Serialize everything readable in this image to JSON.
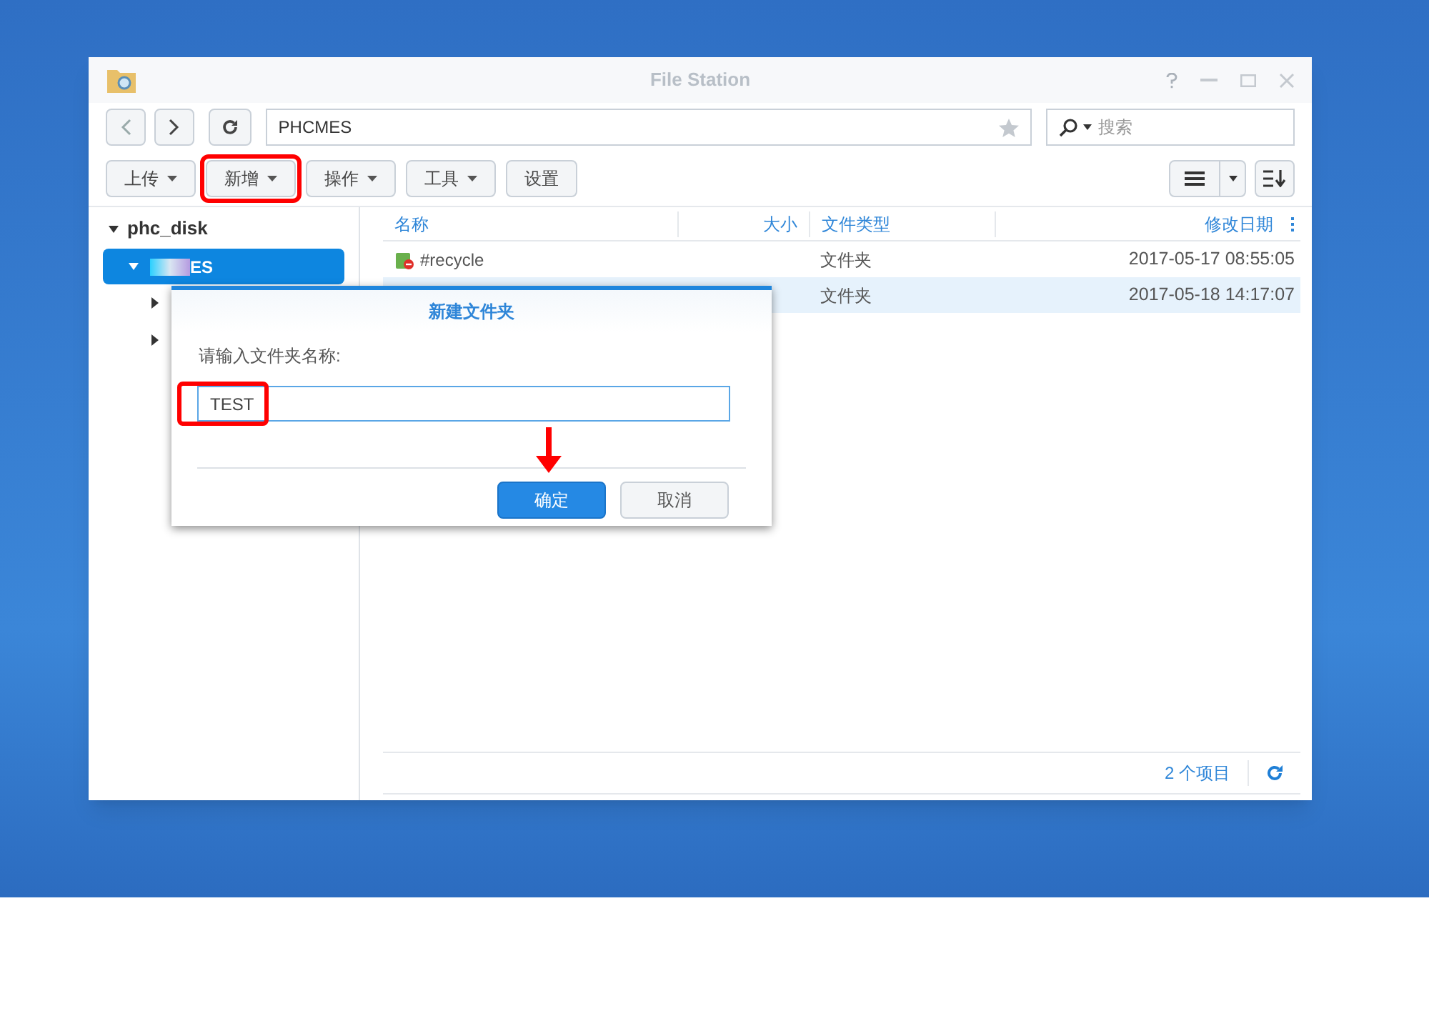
{
  "window": {
    "title": "File Station"
  },
  "path": "PHCMES",
  "search": {
    "placeholder": "搜索"
  },
  "toolbar": [
    "上传",
    "新增",
    "操作",
    "工具",
    "设置"
  ],
  "tree": {
    "root": "phc_disk",
    "items": [
      {
        "label": "ES",
        "selected": true,
        "expanded": true,
        "children": [
          {
            "expanded": false
          },
          {
            "expanded": false
          }
        ]
      }
    ]
  },
  "table": {
    "columns": [
      "名称",
      "大小",
      "文件类型",
      "修改日期"
    ],
    "rows": [
      {
        "name": "#recycle",
        "kind": "recycle",
        "type": "文件夹",
        "modified": "2017-05-17 08:55:05",
        "selected": false
      },
      {
        "kind": "folder",
        "type": "文件夹",
        "modified": "2017-05-18 14:17:07",
        "selected": true
      }
    ]
  },
  "status": {
    "count": "2 个项目"
  },
  "dialog": {
    "title": "新建文件夹",
    "prompt": "请输入文件夹名称:",
    "value": "TEST",
    "buttons": [
      {
        "label": "确定",
        "kind": "primary"
      },
      {
        "label": "取消",
        "kind": "secondary"
      }
    ]
  }
}
